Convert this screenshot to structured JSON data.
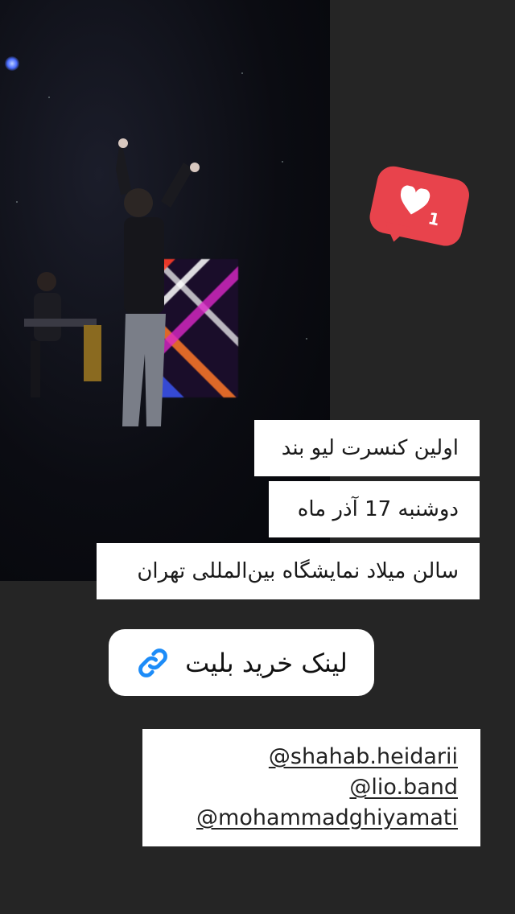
{
  "story": {
    "reaction": {
      "icon": "heart-icon",
      "count": "1"
    },
    "captions": [
      "اولین کنسرت لیو بند",
      "دوشنبه 17 آذر ماه",
      "سالن میلاد نمایشگاه بین‌المللی تهران"
    ],
    "link": {
      "label": "لینک خرید بلیت",
      "icon": "link-icon"
    },
    "mentions": [
      "@shahab.heidarii",
      "@lio.band",
      "@mohammadghiyamati"
    ]
  },
  "colors": {
    "background": "#252525",
    "reaction": "#e8434c",
    "link_icon": "#1d8cf8"
  }
}
